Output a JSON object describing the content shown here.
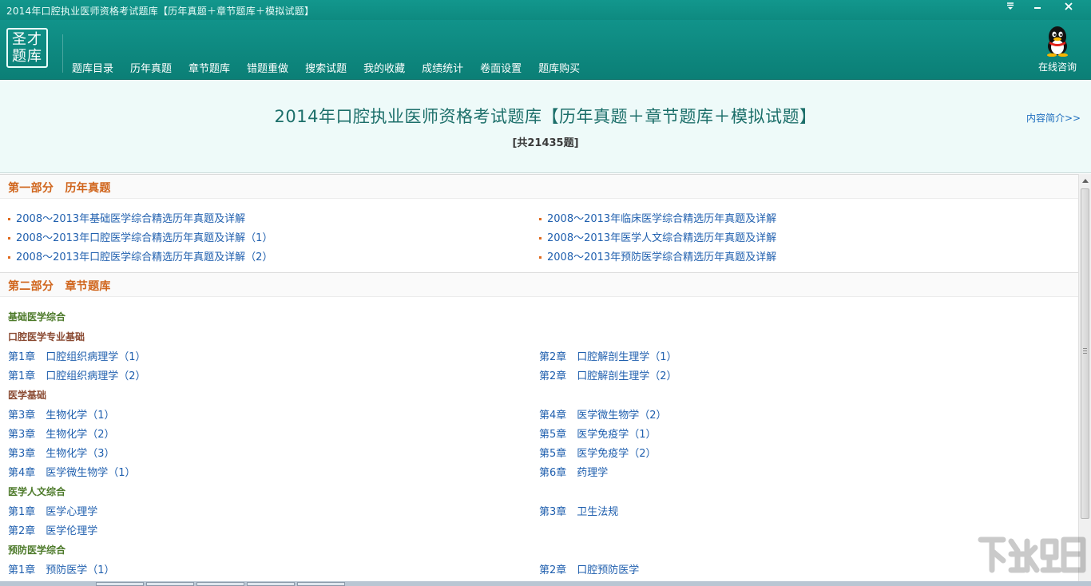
{
  "window": {
    "title": "2014年口腔执业医师资格考试题库【历年真题＋章节题库＋模拟试题】",
    "controls": {
      "menu_icon": "menu-icon",
      "minimize_icon": "minimize-icon",
      "close_icon": "close-icon"
    }
  },
  "logo": {
    "line1": "圣才",
    "line2": "题库"
  },
  "nav": {
    "items": [
      "题库目录",
      "历年真题",
      "章节题库",
      "错题重做",
      "搜索试题",
      "我的收藏",
      "成绩统计",
      "卷面设置",
      "题库购买"
    ],
    "consult_label": "在线咨询",
    "consult_icon": "qq-penguin-icon"
  },
  "header": {
    "title": "2014年口腔执业医师资格考试题库【历年真题＋章节题库＋模拟试题】",
    "count": "[共21435题]",
    "intro_link": "内容简介>>"
  },
  "part1": {
    "heading": "第一部分　历年真题",
    "left": [
      "2008～2013年基础医学综合精选历年真题及详解",
      "2008～2013年口腔医学综合精选历年真题及详解（1）",
      "2008～2013年口腔医学综合精选历年真题及详解（2）"
    ],
    "right": [
      "2008～2013年临床医学综合精选历年真题及详解",
      "2008～2013年医学人文综合精选历年真题及详解",
      "2008～2013年预防医学综合精选历年真题及详解"
    ]
  },
  "part2": {
    "heading": "第二部分　章节题库",
    "cat_basic": "基础医学综合",
    "cat_oral": "口腔医学专业基础",
    "oral_left": [
      "第1章　口腔组织病理学（1）",
      "第1章　口腔组织病理学（2）"
    ],
    "oral_right": [
      "第2章　口腔解剖生理学（1）",
      "第2章　口腔解剖生理学（2）"
    ],
    "cat_med": "医学基础",
    "med_left": [
      "第3章　生物化学（1）",
      "第3章　生物化学（2）",
      "第3章　生物化学（3）",
      "第4章　医学微生物学（1）"
    ],
    "med_right": [
      "第4章　医学微生物学（2）",
      "第5章　医学免疫学（1）",
      "第5章　医学免疫学（2）",
      "第6章　药理学"
    ],
    "cat_humanities": "医学人文综合",
    "hum_left": [
      "第1章　医学心理学",
      "第2章　医学伦理学"
    ],
    "hum_right": [
      "第3章　卫生法规"
    ],
    "cat_prevent": "预防医学综合",
    "prev_left": [
      "第1章　预防医学（1）"
    ],
    "prev_right": [
      "第2章　口腔预防医学"
    ]
  },
  "colors": {
    "teal_bar": "#0e8a80",
    "section_heading": "#d0651c",
    "link": "#1f5fae",
    "header_bg": "#eefaf9",
    "cat_green": "#4d7a2a",
    "cat_brown": "#8a4a32"
  }
}
